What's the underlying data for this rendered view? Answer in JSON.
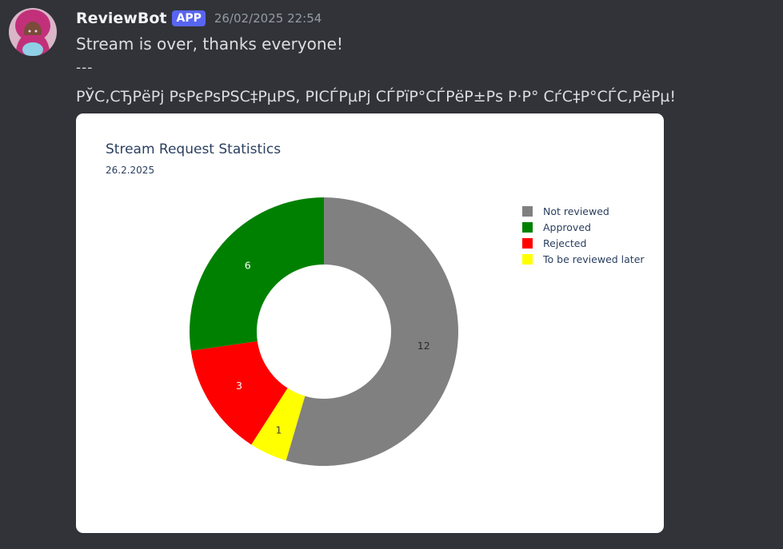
{
  "message": {
    "author": "ReviewBot",
    "badge": "APP",
    "timestamp": "26/02/2025 22:54",
    "lines": [
      "Stream is over, thanks everyone!",
      "---",
      "РЎС‚СЂРёРј РѕРєРѕРЅС‡РµРЅ, РІСЃРµРј СЃРїР°СЃРёР±Рѕ Р·Р° СѓС‡Р°СЃС‚РёРµ!"
    ]
  },
  "colors": {
    "background": "#313338",
    "app_badge": "#5865f2",
    "not_reviewed": "#808080",
    "approved": "#008000",
    "rejected": "#ff0000",
    "later": "#ffff00"
  },
  "chart_data": {
    "type": "pie",
    "donut": true,
    "title": "Stream Request Statistics",
    "subtitle": "26.2.2025",
    "legend_position": "right",
    "series": [
      {
        "name": "Not reviewed",
        "value": 12,
        "color": "#808080"
      },
      {
        "name": "Approved",
        "value": 6,
        "color": "#008000"
      },
      {
        "name": "Rejected",
        "value": 3,
        "color": "#ff0000"
      },
      {
        "name": "To be reviewed later",
        "value": 1,
        "color": "#ffff00"
      }
    ],
    "slice_order_clockwise_from_top": [
      "Not reviewed",
      "To be reviewed later",
      "Rejected",
      "Approved"
    ]
  }
}
